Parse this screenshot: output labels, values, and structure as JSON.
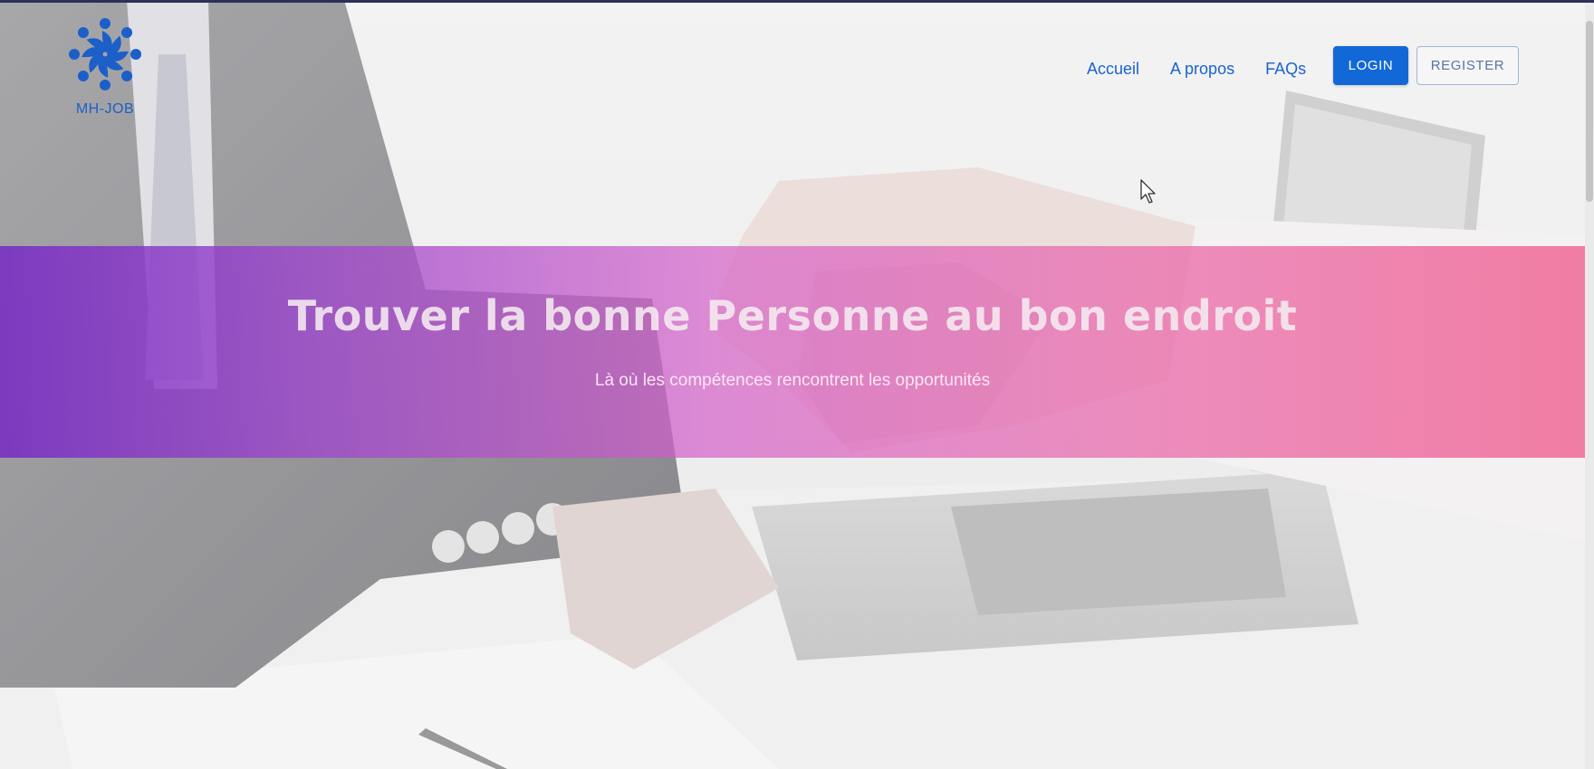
{
  "brand": {
    "name": "MH-JOB",
    "logo_icon": "pinwheel-people-icon",
    "color": "#1c5fc8"
  },
  "nav": {
    "items": [
      {
        "label": "Accueil"
      },
      {
        "label": "A propos"
      },
      {
        "label": "FAQs"
      }
    ],
    "link_color": "#1a63cf"
  },
  "actions": {
    "login_label": "LOGIN",
    "register_label": "REGISTER",
    "login_color": "#1268d6"
  },
  "hero": {
    "title": "Trouver la bonne Personne au bon endroit",
    "subtitle": "Là où les compétences rencontrent les opportunités",
    "gradient_start": "#762ac4",
    "gradient_end": "#f06a96"
  },
  "background": {
    "image": "handshake-over-desk-with-laptop"
  }
}
